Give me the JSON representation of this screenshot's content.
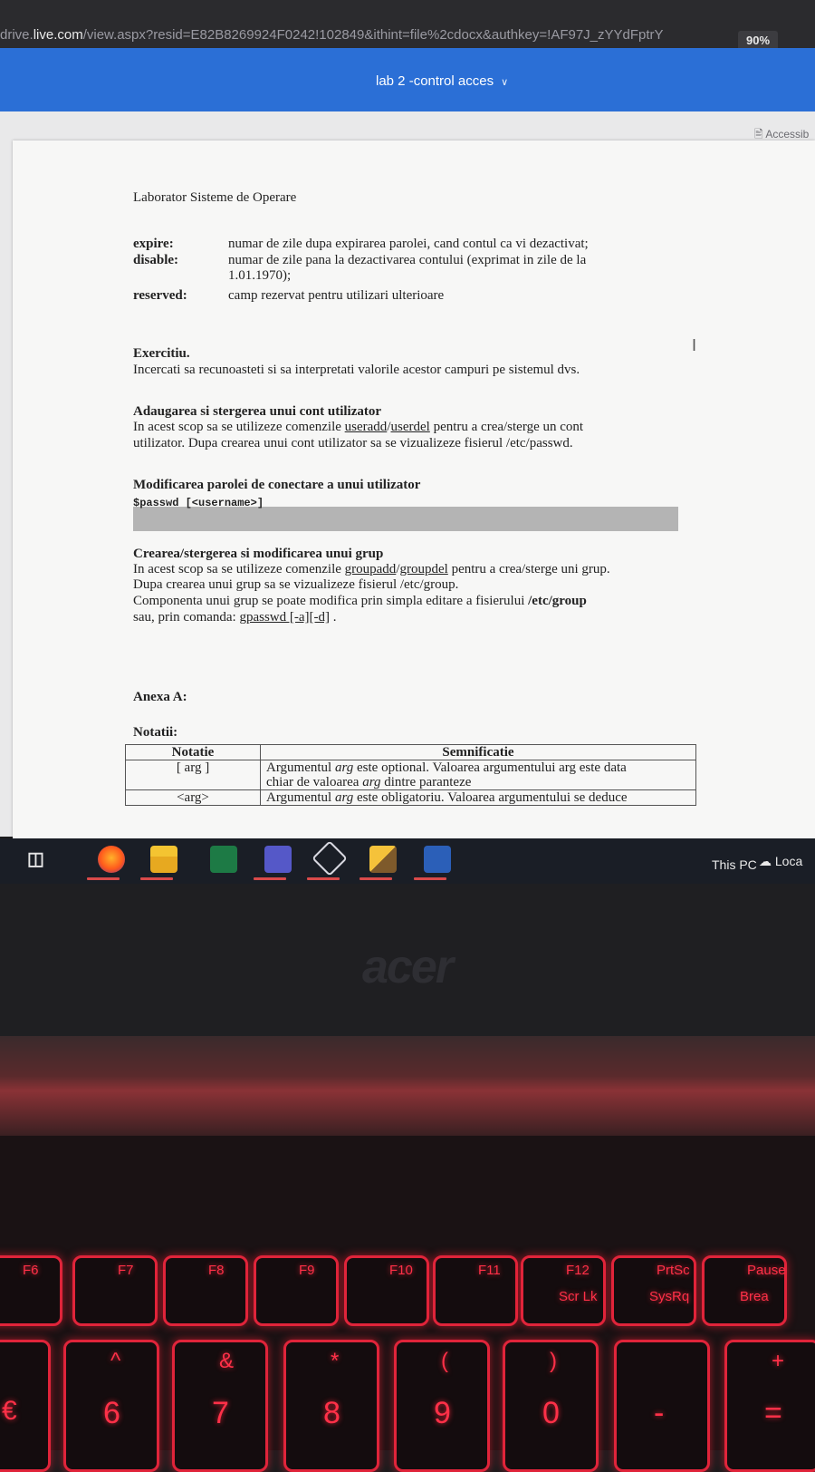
{
  "browser": {
    "url_prefix": "drive.",
    "url_domain": "live.com",
    "url_path": "/view.aspx?resid=E82B8269924F0242!102849&ithint=file%2cdocx&authkey=!AF97J_zYYdFptrY",
    "zoom": "90%"
  },
  "word": {
    "doc_title": "lab 2 -control acces",
    "accessibility_label": "Accessib"
  },
  "document": {
    "header": "Laborator Sisteme de Operare",
    "fields": [
      {
        "key": "expire:",
        "value": "numar de zile dupa expirarea parolei, cand contul ca vi dezactivat;"
      },
      {
        "key": "disable:",
        "value": "numar de zile pana la dezactivarea contului (exprimat in zile de la",
        "value2": "1.01.1970);"
      },
      {
        "key": "reserved:",
        "value": "camp rezervat pentru utilizari ulterioare"
      }
    ],
    "exercise_title": "Exercitiu.",
    "exercise_text": "Incercati sa recunoasteti si sa interpretati valorile acestor campuri pe sistemul dvs.",
    "sec1_title": "Adaugarea si stergerea unui cont utilizator",
    "sec1_l1_a": "In acest scop sa se utilizeze comenzile ",
    "sec1_l1_cmd1": "useradd",
    "sec1_l1_sep": "/",
    "sec1_l1_cmd2": "userdel",
    "sec1_l1_b": " pentru a crea/sterge un cont",
    "sec1_l2": "utilizator. Dupa crearea unui cont utilizator sa se vizualizeze fisierul /etc/passwd.",
    "sec2_title": "Modificarea parolei de conectare a unui utilizator",
    "sec2_code": "$passwd [<username>]",
    "sec3_title": "Crearea/stergerea si modificarea unui grup",
    "sec3_l1_a": "In acest scop sa se utilizeze comenzile ",
    "sec3_l1_cmd1": "groupadd",
    "sec3_l1_sep": "/",
    "sec3_l1_cmd2": "groupdel",
    "sec3_l1_b": " pentru a crea/sterge uni grup.",
    "sec3_l2": "Dupa crearea unui grup sa se vizualizeze fisierul /etc/group.",
    "sec3_l3_a": "Componenta unui grup se poate modifica prin simpla editare a fisierului ",
    "sec3_l3_bold": "/etc/group",
    "sec3_l4_a": "sau, prin comanda: ",
    "sec3_l4_cmd": "gpasswd [-a][-d]",
    "sec3_l4_b": " .",
    "annex_title": "Anexa A:",
    "notes_title": "Notatii:",
    "table": {
      "headers": [
        "Notatie",
        "Semnificatie"
      ],
      "rows": [
        {
          "notation": "[ arg ]",
          "meaning_a": "Argumentul ",
          "meaning_em": "arg",
          "meaning_b": " este optional. Valoarea argumentului arg este data",
          "meaning2_a": "chiar de valoarea ",
          "meaning2_em": "arg",
          "meaning2_b": " dintre paranteze"
        },
        {
          "notation": "<arg>",
          "meaning_a": "Argumentul ",
          "meaning_em": "arg",
          "meaning_b": " este obligatoriu. Valoarea argumentului se deduce"
        }
      ]
    }
  },
  "taskbar": {
    "this_pc": "This PC",
    "loca": "Loca",
    "apps": [
      "task-view-icon",
      "firefox-icon",
      "file-explorer-icon",
      "excel-icon",
      "teams-icon",
      "3d-viewer-icon",
      "sublime-icon",
      "word-icon"
    ]
  },
  "laptop": {
    "brand": "acer",
    "fkeys": [
      {
        "label": "F6"
      },
      {
        "label": "F7"
      },
      {
        "label": "F8"
      },
      {
        "label": "F9"
      },
      {
        "label": "F10"
      },
      {
        "label": "F11"
      },
      {
        "label": "F12",
        "sub": "Scr Lk"
      },
      {
        "label": "PrtSc",
        "sub": "SysRq"
      },
      {
        "label": "Pause",
        "sub": "Brea"
      }
    ],
    "numkeys": [
      {
        "top": "^",
        "main": "6"
      },
      {
        "top": "&",
        "main": "7"
      },
      {
        "top": "*",
        "main": "8"
      },
      {
        "top": "(",
        "main": "9"
      },
      {
        "top": ")",
        "main": "0"
      },
      {
        "top": "",
        "main": "-"
      },
      {
        "top": "+",
        "main": "="
      }
    ],
    "euro": "€"
  }
}
